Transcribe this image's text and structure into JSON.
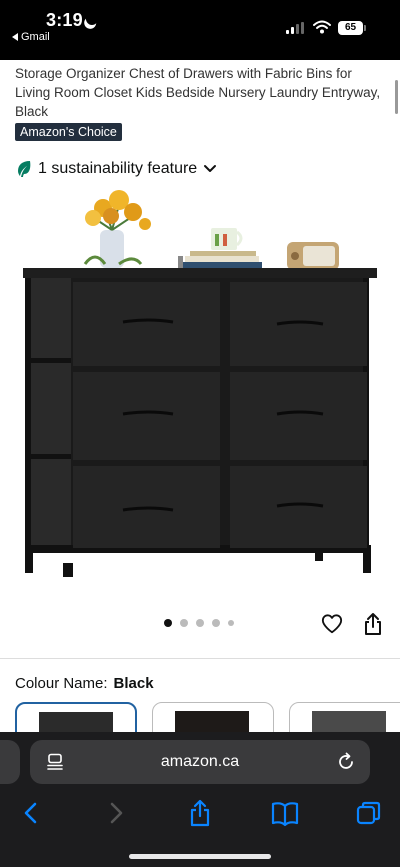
{
  "status_bar": {
    "time": "3:19",
    "back_app": "Gmail",
    "battery": "65"
  },
  "product": {
    "title": "Storage Organizer Chest of Drawers with Fabric Bins for Living Room Closet Kids Bedside Nursery Laundry Entryway, Black",
    "badge": "Amazon's Choice",
    "sustainability": "1 sustainability feature"
  },
  "gallery": {
    "image_count": 5,
    "active_index": 0
  },
  "colour": {
    "label": "Colour Name:",
    "value": "Black"
  },
  "browser": {
    "url": "amazon.ca"
  },
  "colors": {
    "accent_blue": "#2162a1",
    "leaf_green": "#067d62",
    "toolbar_blue": "#0a84ff",
    "badge_bg": "#232f3e"
  },
  "icons": [
    "moon-icon",
    "signal-icon",
    "wifi-icon",
    "leaf-icon",
    "chevron-down-icon",
    "heart-icon",
    "share-icon",
    "page-menu-icon",
    "reload-icon",
    "back-icon",
    "forward-icon",
    "share-icon",
    "bookmarks-icon",
    "tabs-icon"
  ]
}
